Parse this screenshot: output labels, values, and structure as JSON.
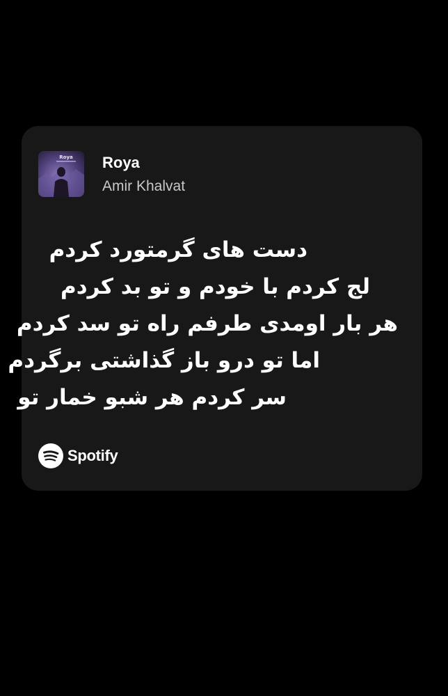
{
  "track": {
    "title": "Roya",
    "artist": "Amir Khalvat",
    "cover_text": "Roya"
  },
  "lyrics": [
    "دست های گرمتورد کردم",
    "لج کردم با خودم و تو بد کردم",
    "هر بار اومدی طرفم راه تو سد کردم",
    "اما تو درو باز گذاشتی برگردم",
    "سر کردم هر شبو خمار تو"
  ],
  "brand": {
    "name": "Spotify",
    "icon": "spotify-logo-icon"
  },
  "colors": {
    "background": "#000000",
    "card": "#181818",
    "title": "#ffffff",
    "artist": "#c9c9c9",
    "lyrics": "#ffffff"
  }
}
